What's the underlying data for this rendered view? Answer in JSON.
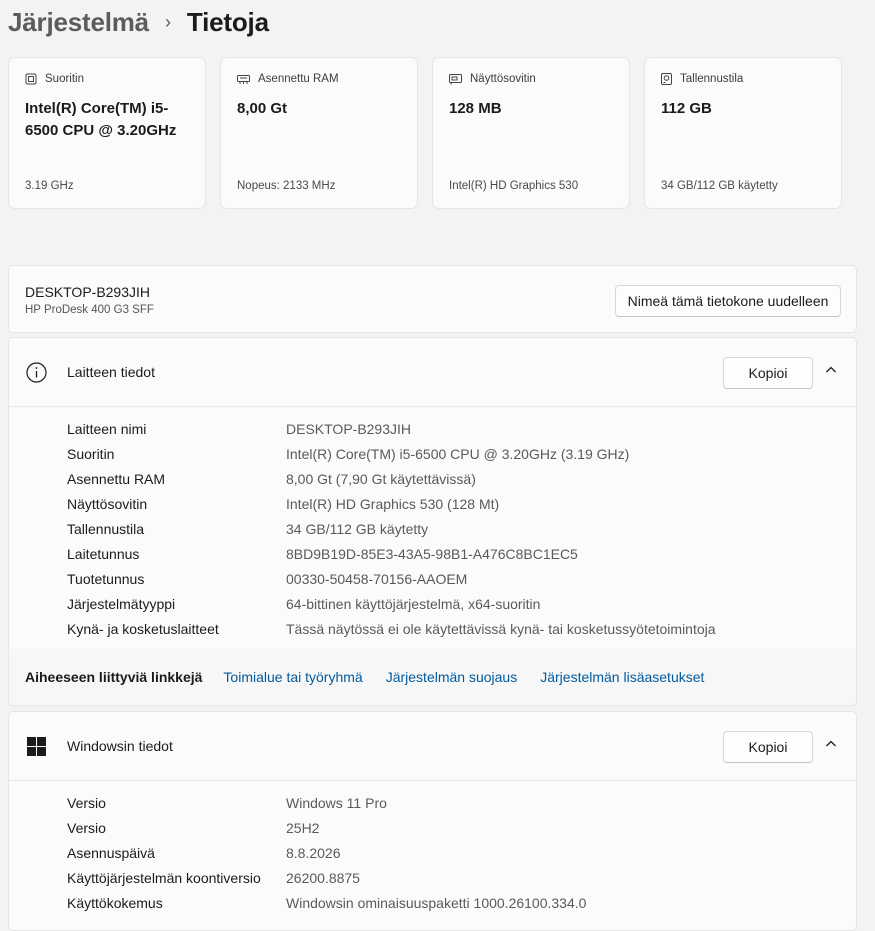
{
  "breadcrumb": {
    "parent": "Järjestelmä",
    "separator": "›",
    "current": "Tietoja"
  },
  "cards": [
    {
      "icon": "processor-icon",
      "title": "Suoritin",
      "value": "Intel(R) Core(TM) i5-6500 CPU @ 3.20GHz",
      "sub": "3.19 GHz"
    },
    {
      "icon": "ram-icon",
      "title": "Asennettu RAM",
      "value": "8,00 Gt",
      "sub": "Nopeus: 2133 MHz"
    },
    {
      "icon": "gpu-icon",
      "title": "Näyttösovitin",
      "value": "128 MB",
      "sub": "Intel(R) HD Graphics 530"
    },
    {
      "icon": "storage-icon",
      "title": "Tallennustila",
      "value": "112 GB",
      "sub": "34 GB/112 GB käytetty"
    }
  ],
  "device": {
    "name": "DESKTOP-B293JIH",
    "model": "HP ProDesk 400 G3 SFF",
    "rename_label": "Nimeä tämä tietokone uudelleen"
  },
  "device_info": {
    "title": "Laitteen tiedot",
    "copy_label": "Kopioi",
    "rows": [
      {
        "label": "Laitteen nimi",
        "value": "DESKTOP-B293JIH"
      },
      {
        "label": "Suoritin",
        "value": "Intel(R) Core(TM) i5-6500 CPU @ 3.20GHz (3.19 GHz)"
      },
      {
        "label": "Asennettu RAM",
        "value": "8,00 Gt (7,90 Gt käytettävissä)"
      },
      {
        "label": "Näyttösovitin",
        "value": "Intel(R) HD Graphics 530 (128 Mt)"
      },
      {
        "label": "Tallennustila",
        "value": "34 GB/112 GB käytetty"
      },
      {
        "label": "Laitetunnus",
        "value": "8BD9B19D-85E3-43A5-98B1-A476C8BC1EC5"
      },
      {
        "label": "Tuotetunnus",
        "value": "00330-50458-70156-AAOEM"
      },
      {
        "label": "Järjestelmätyyppi",
        "value": "64-bittinen käyttöjärjestelmä, x64-suoritin"
      },
      {
        "label": "Kynä- ja kosketuslaitteet",
        "value": "Tässä näytössä ei ole käytettävissä kynä- tai kosketussyötetoimintoja"
      }
    ]
  },
  "related_links": {
    "title": "Aiheeseen liittyviä linkkejä",
    "links": [
      "Toimialue tai työryhmä",
      "Järjestelmän suojaus",
      "Järjestelmän lisäasetukset"
    ]
  },
  "windows_info": {
    "title": "Windowsin tiedot",
    "copy_label": "Kopioi",
    "rows": [
      {
        "label": "Versio",
        "value": "Windows 11 Pro"
      },
      {
        "label": "Versio",
        "value": "25H2"
      },
      {
        "label": "Asennuspäivä",
        "value": "8.8.2026"
      },
      {
        "label": "Käyttöjärjestelmän koontiversio",
        "value": "26200.8875"
      },
      {
        "label": "Käyttökokemus",
        "value": "Windowsin ominaisuuspaketti 1000.26100.334.0"
      }
    ]
  },
  "colors": {
    "background": "#f3f3f3",
    "card": "#fbfbfb",
    "link": "#005a9e"
  }
}
